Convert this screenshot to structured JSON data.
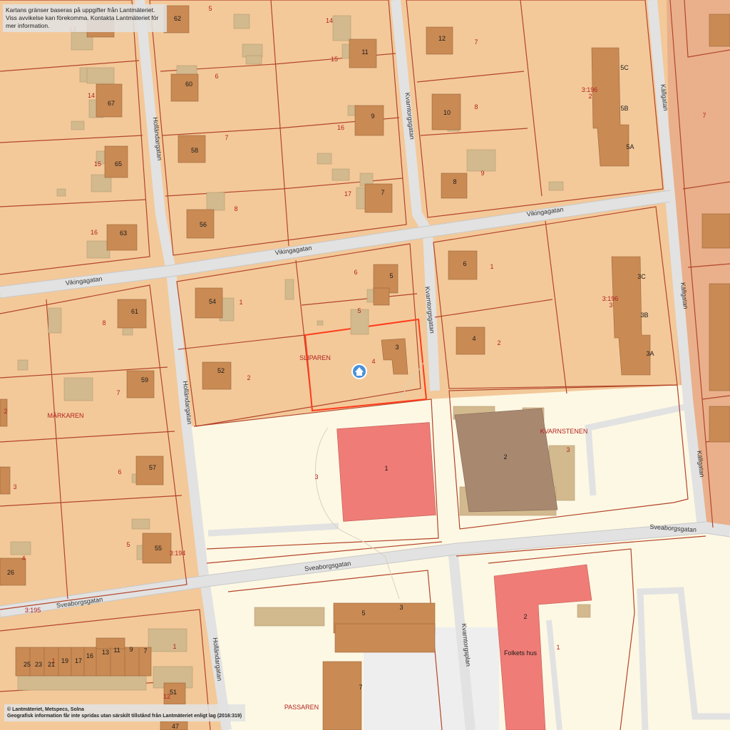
{
  "notices": {
    "top_line1": "Kartans gränser baseras på uppgifter från Lantmäteriet.",
    "top_line2": "Viss avvikelse kan förekomma. Kontakta Lantmäteriet för mer information.",
    "copyright": "© Lantmäteriet, Metspecs, Solna",
    "license": "Geografisk information får inte spridas utan särskilt tillstånd från Lantmäteriet enligt lag (2016:319)"
  },
  "streets": {
    "vikingagatan_w": "Vikingagatan",
    "vikingagatan_c": "Vikingagatan",
    "vikingagatan_e": "Vikingagatan",
    "hollandargatan_n": "Holländargatan",
    "hollandargatan_m": "Holländargatan",
    "hollandargatan_s": "Holländargatan",
    "kvarntorgsgatan_n": "Kvarntorgsgatan",
    "kvarntorgsgatan_m": "Kvarntorgsgatan",
    "kvarntorgsplan": "Kvarntorgsplan",
    "kallgatan_n": "Källgatan",
    "kallgatan_m": "Källgatan",
    "kallgatan_s": "Källgatan",
    "sveaborgsgatan_w": "Sveaborgsgatan",
    "sveaborgsgatan_c": "Sveaborgsgatan",
    "sveaborgsgatan_e": "Sveaborgsgatan"
  },
  "districts": {
    "sliparen": "SLIPAREN",
    "markaren": "MÄRKAREN",
    "kvarnstenen": "KVARNSTENEN",
    "passaren": "PASSAREN"
  },
  "parcel_numbers": {
    "p13": "13",
    "p5a": "5",
    "p14a": "14",
    "p15a": "15",
    "p6a": "6",
    "p7a": "7",
    "p14b": "14",
    "p15b": "15",
    "p16a": "16",
    "p16b": "16",
    "p17": "17",
    "p8a": "8",
    "p7b": "7",
    "p8b": "8",
    "p9a": "9",
    "p3196a": "3:196",
    "p2a": "2",
    "p7c": "7",
    "p6b": "6",
    "p1a": "1",
    "p5b": "5",
    "p4a": "4",
    "p2b": "2",
    "p1b": "1",
    "p2c": "2",
    "p8c": "8",
    "p7d": "7",
    "p6c": "6",
    "p5c": "5",
    "p2d": "2",
    "p3a": "3",
    "p4b": "4",
    "p3196b": "3:196",
    "p3b": "3",
    "p3c": "3",
    "p3d": "3",
    "p3194": "3:194",
    "p3195": "3:195",
    "p1c": "1",
    "p12b": "12",
    "p1d": "1",
    "p1e": "1"
  },
  "house_numbers": {
    "h62": "62",
    "h60": "60",
    "h58": "58",
    "h56": "56",
    "h67": "67",
    "h65": "65",
    "h63": "63",
    "h12": "12",
    "h11": "11",
    "h10": "10",
    "h9": "9",
    "h8": "8",
    "h7": "7",
    "h5c": "5C",
    "h5b": "5B",
    "h5a": "5A",
    "h54": "54",
    "h52": "52",
    "h5": "5",
    "h3": "3",
    "h6": "6",
    "h4": "4",
    "h3c": "3C",
    "h3b": "3B",
    "h3a": "3A",
    "h61": "61",
    "h59": "59",
    "h57": "57",
    "h55": "55",
    "h26": "26",
    "h1": "1",
    "h2": "2",
    "h5s": "5",
    "h3s": "3",
    "h7s": "7",
    "h2s": "2",
    "h51": "51",
    "h47": "47",
    "folkets_hus": "Folkets hus",
    "row": [
      "25",
      "23",
      "21",
      "19",
      "17",
      "16",
      "13",
      "11",
      "9",
      "7"
    ]
  },
  "colors": {
    "residential": "#f3c99a",
    "public_area": "#fdf8e4",
    "road": "#e2e2e2",
    "building": "#c98a54",
    "outbuilding": "#d2b98e",
    "public_building": "#ef7c76",
    "commercial_building": "#a98870",
    "east_zone": "#e9b08b",
    "parcel_line": "#b3452a",
    "selection": "#ff3b1a",
    "marker": "#4a90d9"
  },
  "marker": {
    "icon": "home-icon"
  }
}
